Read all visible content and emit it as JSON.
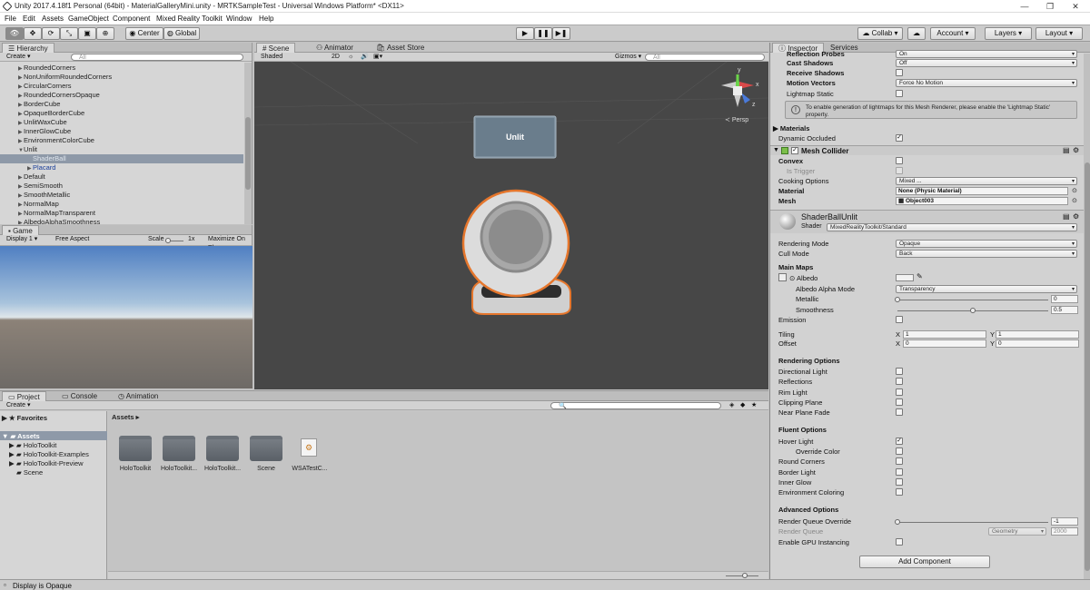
{
  "window": {
    "title": "Unity 2017.4.18f1 Personal (64bit) - MaterialGalleryMini.unity - MRTKSampleTest - Universal Windows Platform* <DX11>",
    "minimize": "—",
    "maximize": "❐",
    "close": "✕"
  },
  "menu": [
    "File",
    "Edit",
    "Assets",
    "GameObject",
    "Component",
    "Mixed Reality Toolkit",
    "Window",
    "Help"
  ],
  "toolbar": {
    "center": "Center",
    "global": "Global",
    "collab": "Collab ▾",
    "account": "Account",
    "layers": "Layers",
    "layout": "Layout"
  },
  "hierarchy": {
    "tab": "Hierarchy",
    "create": "Create",
    "search_placeholder": "All",
    "items": [
      {
        "label": "RoundedCorners",
        "indent": 1,
        "expand": "▶",
        "selected": false
      },
      {
        "label": "NonUniformRoundedCorners",
        "indent": 1,
        "expand": "▶",
        "selected": false
      },
      {
        "label": "CircularCorners",
        "indent": 1,
        "expand": "▶",
        "selected": false
      },
      {
        "label": "RoundedCornersOpaque",
        "indent": 1,
        "expand": "▶",
        "selected": false
      },
      {
        "label": "BorderCube",
        "indent": 1,
        "expand": "▶",
        "selected": false
      },
      {
        "label": "OpaqueBorderCube",
        "indent": 1,
        "expand": "▶",
        "selected": false
      },
      {
        "label": "UnlitWaxCube",
        "indent": 1,
        "expand": "▶",
        "selected": false
      },
      {
        "label": "InnerGlowCube",
        "indent": 1,
        "expand": "▶",
        "selected": false
      },
      {
        "label": "EnvironmentColorCube",
        "indent": 1,
        "expand": "▶",
        "selected": false
      },
      {
        "label": "Unlit",
        "indent": 1,
        "expand": "▼",
        "selected": false
      },
      {
        "label": "ShaderBall",
        "indent": 2,
        "expand": "",
        "selected": true
      },
      {
        "label": "Placard",
        "indent": 2,
        "expand": "▶",
        "selected": false,
        "blue": true
      },
      {
        "label": "Default",
        "indent": 1,
        "expand": "▶",
        "selected": false
      },
      {
        "label": "SemiSmooth",
        "indent": 1,
        "expand": "▶",
        "selected": false
      },
      {
        "label": "SmoothMetallic",
        "indent": 1,
        "expand": "▶",
        "selected": false
      },
      {
        "label": "NormalMap",
        "indent": 1,
        "expand": "▶",
        "selected": false
      },
      {
        "label": "NormalMapTransparent",
        "indent": 1,
        "expand": "▶",
        "selected": false
      },
      {
        "label": "AlbedoAlphaSmoothness",
        "indent": 1,
        "expand": "▶",
        "selected": false
      }
    ]
  },
  "game": {
    "tab": "Game",
    "display": "Display 1",
    "aspect": "Free Aspect",
    "scale_label": "Scale",
    "scale_value": "1x",
    "maximize": "Maximize On Pl"
  },
  "scene": {
    "tabs": [
      "Scene",
      "Animator",
      "Asset Store"
    ],
    "shading": "Shaded",
    "mode2d": "2D",
    "gizmos": "Gizmos",
    "search_placeholder": "All",
    "persp": "Persp",
    "placard_text": "Unlit",
    "axis_y": "y",
    "axis_x": "x",
    "axis_z": "z"
  },
  "project": {
    "tabs": [
      "Project",
      "Console",
      "Animation"
    ],
    "create": "Create",
    "favorites": "Favorites",
    "assets_root": "Assets",
    "breadcrumb": "Assets ▸",
    "tree": [
      "HoloToolkit",
      "HoloToolkit-Examples",
      "HoloToolkit-Preview",
      "Scene"
    ],
    "items": [
      {
        "label": "HoloToolkit",
        "type": "folder"
      },
      {
        "label": "HoloToolkit...",
        "type": "folder"
      },
      {
        "label": "HoloToolkit...",
        "type": "folder"
      },
      {
        "label": "Scene",
        "type": "folder"
      },
      {
        "label": "WSATestC...",
        "type": "file"
      }
    ]
  },
  "inspector": {
    "tabs": [
      "Inspector",
      "Services"
    ],
    "mesh_renderer": {
      "reflection_probes_label": "Reflection Probes",
      "reflection_probes_value": "On",
      "cast_shadows_label": "Cast Shadows",
      "cast_shadows_value": "Off",
      "receive_shadows_label": "Receive Shadows",
      "motion_vectors_label": "Motion Vectors",
      "motion_vectors_value": "Force No Motion",
      "lightmap_static_label": "Lightmap Static",
      "info": "To enable generation of lightmaps for this Mesh Renderer, please enable the 'Lightmap Static' property.",
      "materials_label": "Materials",
      "dynamic_occluded_label": "Dynamic Occluded"
    },
    "mesh_collider": {
      "title": "Mesh Collider",
      "convex_label": "Convex",
      "is_trigger_label": "Is Trigger",
      "cooking_label": "Cooking Options",
      "cooking_value": "Mixed ...",
      "material_label": "Material",
      "material_value": "None (Physic Material)",
      "mesh_label": "Mesh",
      "mesh_value": "Object003"
    },
    "material": {
      "name": "ShaderBallUnlit",
      "shader_label": "Shader",
      "shader_value": "MixedRealityToolkit/Standard",
      "rendering_mode_label": "Rendering Mode",
      "rendering_mode_value": "Opaque",
      "cull_mode_label": "Cull Mode",
      "cull_mode_value": "Back",
      "main_maps_label": "Main Maps",
      "albedo_label": "Albedo",
      "albedo_alpha_label": "Albedo Alpha Mode",
      "albedo_alpha_value": "Transparency",
      "metallic_label": "Metallic",
      "metallic_value": "0",
      "metallic_fraction": 0.0,
      "smoothness_label": "Smoothness",
      "smoothness_value": "0.5",
      "smoothness_fraction": 0.5,
      "emission_label": "Emission",
      "tiling_label": "Tiling",
      "offset_label": "Offset",
      "x_label": "X",
      "y_label": "Y",
      "tiling_x": "1",
      "tiling_y": "1",
      "offset_x": "0",
      "offset_y": "0",
      "rendering_options_label": "Rendering Options",
      "directional_light": "Directional Light",
      "reflections": "Reflections",
      "rim_light": "Rim Light",
      "clipping_plane": "Clipping Plane",
      "near_plane_fade": "Near Plane Fade",
      "fluent_options_label": "Fluent Options",
      "hover_light": "Hover Light",
      "override_color": "Override Color",
      "round_corners": "Round Corners",
      "border_light": "Border Light",
      "inner_glow": "Inner Glow",
      "environment_coloring": "Environment Coloring",
      "advanced_options_label": "Advanced Options",
      "render_queue_override_label": "Render Queue Override",
      "render_queue_override_value": "-1",
      "render_queue_label": "Render Queue",
      "render_queue_dd": "Geometry",
      "render_queue_value": "2000",
      "gpu_instancing_label": "Enable GPU Instancing"
    },
    "add_component": "Add Component"
  },
  "status": {
    "text": "Display is Opaque"
  },
  "colors": {
    "selection": "#8e99a8",
    "accent_orange": "#e5762c",
    "scene_bg": "#474747"
  }
}
